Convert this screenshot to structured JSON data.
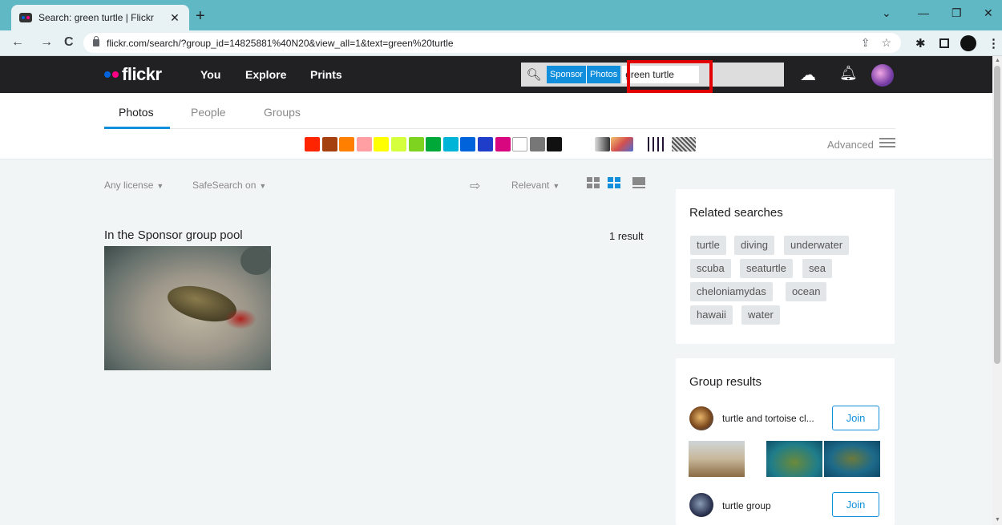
{
  "browser": {
    "tab_title": "Search: green turtle | Flickr",
    "tab_close": "✕",
    "new_tab": "+",
    "url": "flickr.com/search/?group_id=14825881%40N20&view_all=1&text=green%20turtle",
    "window_controls": [
      "⌄",
      "—",
      "❐",
      "✕"
    ],
    "nav": [
      "←",
      "→",
      "C"
    ],
    "omnibox_icons": [
      "share-icon",
      "star-icon"
    ],
    "extension_icons": [
      "puzzle-icon",
      "sidepanel-icon",
      "profile-icon",
      "menu-icon"
    ]
  },
  "header": {
    "logo": "flickr",
    "nav": [
      "You",
      "Explore",
      "Prints"
    ],
    "search": {
      "scope_sponsor": "Sponsor",
      "scope_photos": "Photos",
      "query": "green turtle"
    },
    "icons": [
      "upload-icon",
      "bell-icon",
      "avatar"
    ]
  },
  "search_tabs": [
    "Photos",
    "People",
    "Groups"
  ],
  "active_tab": "Photos",
  "color_filters": [
    "#ff2400",
    "#a4410e",
    "#ff7f00",
    "#ff9fa3",
    "#ffff00",
    "#d5ff3c",
    "#7ed321",
    "#00a83a",
    "#00b4d8",
    "#0063dc",
    "#1f3dc9",
    "#d8067f",
    "#ffffff",
    "#777777",
    "#111111"
  ],
  "style_filters": [
    "black-and-white-icon",
    "shallow-depth-icon",
    "minimalist-icon",
    "patterns-icon"
  ],
  "advanced_label": "Advanced",
  "filters": {
    "license": "Any license",
    "safesearch": "SafeSearch on",
    "sort": "Relevant"
  },
  "results": {
    "pool_title": "In the Sponsor group pool",
    "count": "1 result"
  },
  "related_searches": {
    "title": "Related searches",
    "tags": [
      "turtle",
      "diving",
      "underwater",
      "scuba",
      "seaturtle",
      "sea",
      "cheloniamydas",
      "ocean",
      "hawaii",
      "water"
    ]
  },
  "group_results": {
    "title": "Group results",
    "groups": [
      {
        "name": "turtle and tortoise cl...",
        "join": "Join"
      },
      {
        "name": "turtle group",
        "join": "Join"
      }
    ]
  },
  "accent_color": "#128fdc"
}
